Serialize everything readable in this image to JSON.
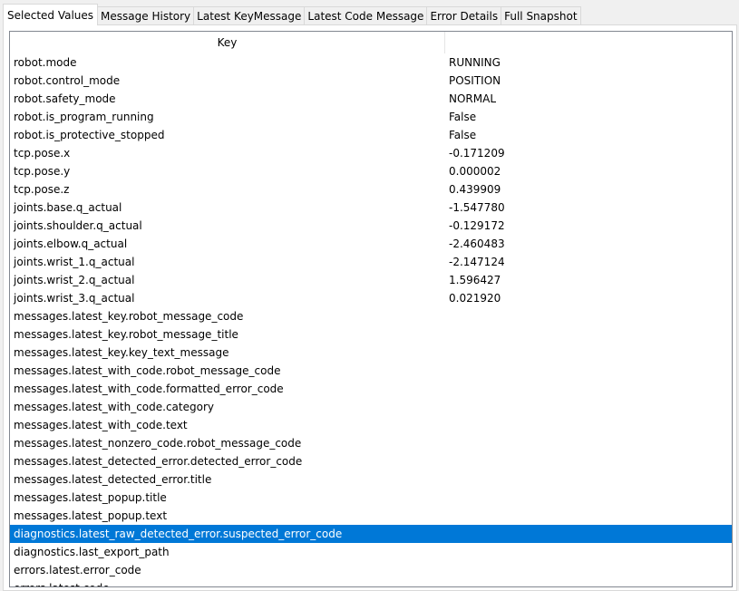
{
  "tabs": [
    {
      "label": "Selected Values",
      "active": true
    },
    {
      "label": "Message History",
      "active": false
    },
    {
      "label": "Latest KeyMessage",
      "active": false
    },
    {
      "label": "Latest Code Message",
      "active": false
    },
    {
      "label": "Error Details",
      "active": false
    },
    {
      "label": "Full Snapshot",
      "active": false
    }
  ],
  "table": {
    "columns": {
      "key": "Key",
      "value": ""
    },
    "selected_row": 26,
    "rows": [
      {
        "key": "robot.mode",
        "value": "RUNNING"
      },
      {
        "key": "robot.control_mode",
        "value": "POSITION"
      },
      {
        "key": "robot.safety_mode",
        "value": "NORMAL"
      },
      {
        "key": "robot.is_program_running",
        "value": "False"
      },
      {
        "key": "robot.is_protective_stopped",
        "value": "False"
      },
      {
        "key": "tcp.pose.x",
        "value": "-0.171209"
      },
      {
        "key": "tcp.pose.y",
        "value": "0.000002"
      },
      {
        "key": "tcp.pose.z",
        "value": "0.439909"
      },
      {
        "key": "joints.base.q_actual",
        "value": "-1.547780"
      },
      {
        "key": "joints.shoulder.q_actual",
        "value": "-0.129172"
      },
      {
        "key": "joints.elbow.q_actual",
        "value": "-2.460483"
      },
      {
        "key": "joints.wrist_1.q_actual",
        "value": "-2.147124"
      },
      {
        "key": "joints.wrist_2.q_actual",
        "value": "1.596427"
      },
      {
        "key": "joints.wrist_3.q_actual",
        "value": "0.021920"
      },
      {
        "key": "messages.latest_key.robot_message_code",
        "value": ""
      },
      {
        "key": "messages.latest_key.robot_message_title",
        "value": ""
      },
      {
        "key": "messages.latest_key.key_text_message",
        "value": ""
      },
      {
        "key": "messages.latest_with_code.robot_message_code",
        "value": ""
      },
      {
        "key": "messages.latest_with_code.formatted_error_code",
        "value": ""
      },
      {
        "key": "messages.latest_with_code.category",
        "value": ""
      },
      {
        "key": "messages.latest_with_code.text",
        "value": ""
      },
      {
        "key": "messages.latest_nonzero_code.robot_message_code",
        "value": ""
      },
      {
        "key": "messages.latest_detected_error.detected_error_code",
        "value": ""
      },
      {
        "key": "messages.latest_detected_error.title",
        "value": ""
      },
      {
        "key": "messages.latest_popup.title",
        "value": ""
      },
      {
        "key": "messages.latest_popup.text",
        "value": ""
      },
      {
        "key": "diagnostics.latest_raw_detected_error.suspected_error_code",
        "value": ""
      },
      {
        "key": "diagnostics.last_export_path",
        "value": ""
      },
      {
        "key": "errors.latest.error_code",
        "value": ""
      },
      {
        "key": "errors.latest.code",
        "value": ""
      }
    ]
  },
  "colors": {
    "selection": "#0078d7",
    "selection_text": "#ffffff",
    "window_bg": "#f0f0f0"
  }
}
